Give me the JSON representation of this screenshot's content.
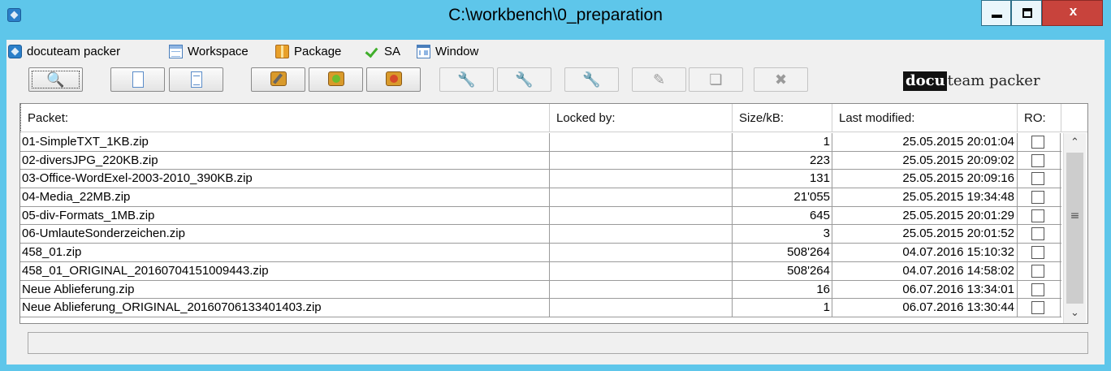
{
  "window": {
    "title": "C:\\workbench\\0_preparation",
    "close_label": "x"
  },
  "menubar": {
    "items": [
      {
        "label": "docuteam packer",
        "icon": "app-icon"
      },
      {
        "label": "Workspace",
        "icon": "workspace-icon"
      },
      {
        "label": "Package",
        "icon": "package-icon"
      },
      {
        "label": "SA",
        "icon": "checkmark-icon"
      },
      {
        "label": "Window",
        "icon": "window-icon"
      }
    ]
  },
  "toolbar": {
    "buttons": [
      {
        "icon": "search-icon",
        "enabled": true
      },
      {
        "icon": "new-document-icon",
        "enabled": true
      },
      {
        "icon": "document-lines-icon",
        "enabled": true
      },
      {
        "icon": "package-edit-icon",
        "enabled": true
      },
      {
        "icon": "package-open-icon",
        "enabled": true
      },
      {
        "icon": "package-delete-icon",
        "enabled": true
      },
      {
        "icon": "wrench-icon",
        "enabled": false
      },
      {
        "icon": "wrench-plus-icon",
        "enabled": false
      },
      {
        "icon": "wrench-minus-icon",
        "enabled": false
      },
      {
        "icon": "pencil-icon",
        "enabled": false
      },
      {
        "icon": "copy-icon",
        "enabled": false
      },
      {
        "icon": "close-icon",
        "enabled": false
      }
    ],
    "logo": {
      "dark": "docu",
      "light": "team packer"
    }
  },
  "table": {
    "columns": [
      "Packet:",
      "Locked by:",
      "Size/kB:",
      "Last modified:",
      "RO:"
    ],
    "rows": [
      {
        "packet": "01-SimpleTXT_1KB.zip",
        "locked_by": "",
        "size": "1",
        "modified": "25.05.2015 20:01:04",
        "ro": false
      },
      {
        "packet": "02-diversJPG_220KB.zip",
        "locked_by": "",
        "size": "223",
        "modified": "25.05.2015 20:09:02",
        "ro": false
      },
      {
        "packet": "03-Office-WordExel-2003-2010_390KB.zip",
        "locked_by": "",
        "size": "131",
        "modified": "25.05.2015 20:09:16",
        "ro": false
      },
      {
        "packet": "04-Media_22MB.zip",
        "locked_by": "",
        "size": "21'055",
        "modified": "25.05.2015 19:34:48",
        "ro": false
      },
      {
        "packet": "05-div-Formats_1MB.zip",
        "locked_by": "",
        "size": "645",
        "modified": "25.05.2015 20:01:29",
        "ro": false
      },
      {
        "packet": "06-UmlauteSonderzeichen.zip",
        "locked_by": "",
        "size": "3",
        "modified": "25.05.2015 20:01:52",
        "ro": false
      },
      {
        "packet": "458_01.zip",
        "locked_by": "",
        "size": "508'264",
        "modified": "04.07.2016 15:10:32",
        "ro": false
      },
      {
        "packet": "458_01_ORIGINAL_20160704151009443.zip",
        "locked_by": "",
        "size": "508'264",
        "modified": "04.07.2016 14:58:02",
        "ro": false
      },
      {
        "packet": "Neue Ablieferung.zip",
        "locked_by": "",
        "size": "16",
        "modified": "06.07.2016 13:34:01",
        "ro": false
      },
      {
        "packet": "Neue Ablieferung_ORIGINAL_20160706133401403.zip",
        "locked_by": "",
        "size": "1",
        "modified": "06.07.2016 13:30:44",
        "ro": false
      }
    ]
  },
  "status": {
    "text": ""
  }
}
